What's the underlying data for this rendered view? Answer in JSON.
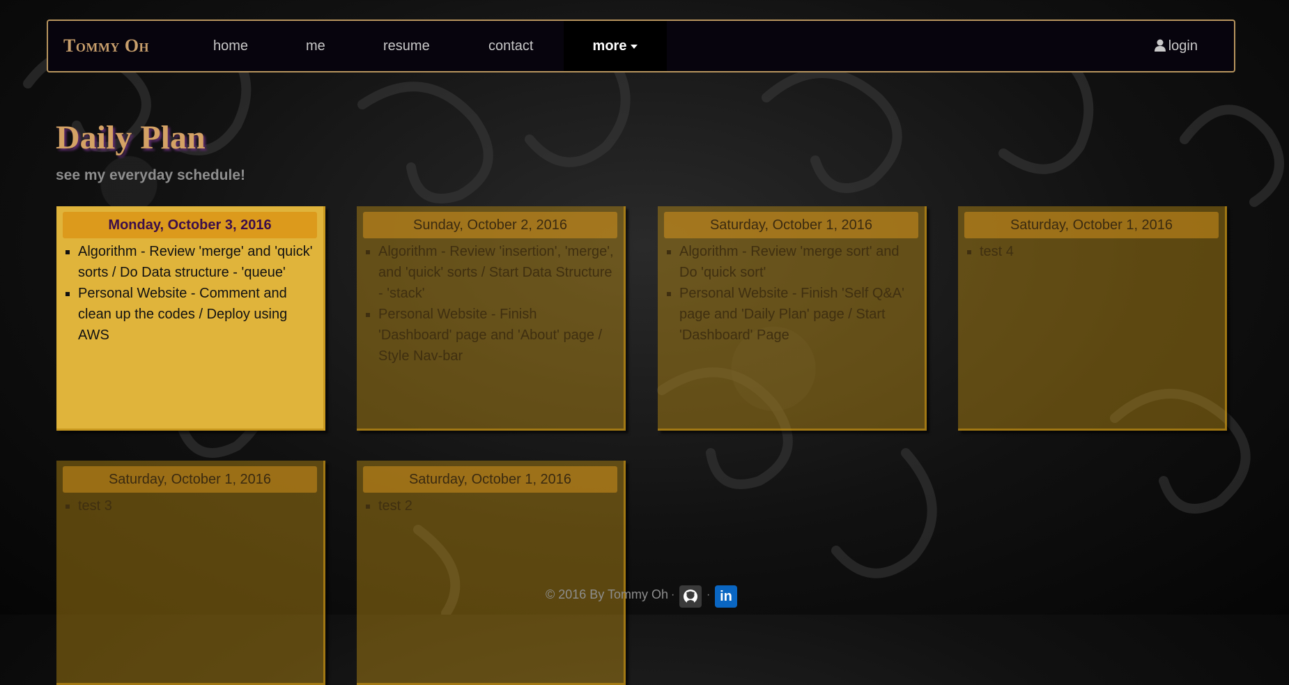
{
  "nav": {
    "brand": "Tommy Oh",
    "links": [
      "home",
      "me",
      "resume",
      "contact"
    ],
    "more": "more",
    "login": "login"
  },
  "page": {
    "title": "Daily Plan",
    "subtitle": "see my everyday schedule!"
  },
  "cards": [
    {
      "date": "Monday, October 3, 2016",
      "items": [
        "Algorithm - Review 'merge' and 'quick' sorts / Do Data structure - 'queue'",
        "Personal Website - Comment and clean up the codes / Deploy using AWS"
      ]
    },
    {
      "date": "Sunday, October 2, 2016",
      "items": [
        "Algorithm - Review 'insertion', 'merge', and 'quick' sorts / Start Data Structure - 'stack'",
        "Personal Website - Finish 'Dashboard' page and 'About' page / Style Nav-bar"
      ]
    },
    {
      "date": "Saturday, October 1, 2016",
      "items": [
        "Algorithm - Review 'merge sort' and Do 'quick sort'",
        "Personal Website - Finish 'Self Q&A' page and 'Daily Plan' page / Start 'Dashboard' Page"
      ]
    },
    {
      "date": "Saturday, October 1, 2016",
      "items": [
        "test 4"
      ]
    },
    {
      "date": "Saturday, October 1, 2016",
      "items": [
        "test 3"
      ]
    },
    {
      "date": "Saturday, October 1, 2016",
      "items": [
        "test 2"
      ]
    }
  ],
  "footer": {
    "copyright": "© 2016 By Tommy Oh",
    "separator": "·",
    "linkedin_glyph": "in"
  },
  "icons": {
    "user": "user-icon",
    "caret": "caret-down-icon",
    "github": "github-icon",
    "linkedin": "linkedin-icon"
  },
  "colors": {
    "brand": "#c89f6c",
    "active_card": "#e0b43b",
    "card_header": "#dc9a1c"
  }
}
